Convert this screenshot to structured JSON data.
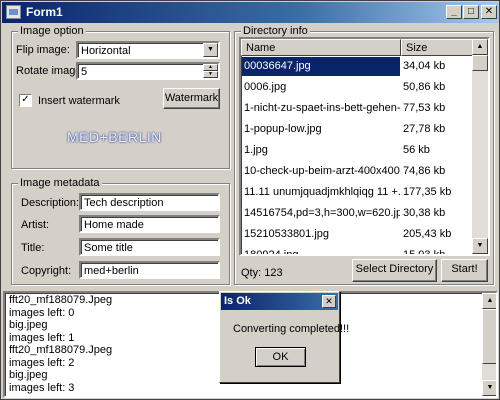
{
  "window": {
    "title": "Form1",
    "minimize": "_",
    "maximize": "□",
    "close": "✕",
    "icon": "app-icon"
  },
  "image_option": {
    "legend": "Image option",
    "flip_label": "Flip image:",
    "flip_value": "Horizontal",
    "rotate_label": "Rotate image:",
    "rotate_value": "5",
    "insert_watermark_label": "Insert watermark",
    "insert_watermark_checked": true,
    "watermark_button": "Watermark",
    "watermark_preview": "MED+BERLIN"
  },
  "image_metadata": {
    "legend": "Image metadata",
    "description_label": "Description:",
    "description_value": "Tech description",
    "artist_label": "Artist:",
    "artist_value": "Home made",
    "title_label": "Title:",
    "title_value": "Some title",
    "copyright_label": "Copyright:",
    "copyright_value": "med+berlin"
  },
  "directory_info": {
    "legend": "Directory info",
    "columns": {
      "name": "Name",
      "size": "Size"
    },
    "files": [
      {
        "name": "00036647.jpg",
        "size": "34,04 kb",
        "selected": true
      },
      {
        "name": "0006.jpg",
        "size": "50,86 kb"
      },
      {
        "name": "1-nicht-zu-spaet-ins-bett-gehen-40...",
        "size": "77,53 kb"
      },
      {
        "name": "1-popup-low.jpg",
        "size": "27,78 kb"
      },
      {
        "name": "1.jpg",
        "size": "56 kb"
      },
      {
        "name": "10-check-up-beim-arzt-400x400-1...",
        "size": "74,86 kb"
      },
      {
        "name": "11.11 unumjquadjmkhlqiqg 11 +.jpg",
        "size": "177,35 kb"
      },
      {
        "name": "14516754,pd=3,h=300,w=620.jpg",
        "size": "30,38 kb"
      },
      {
        "name": "15210533801.jpg",
        "size": "205,43 kb"
      },
      {
        "name": "180924.jpg",
        "size": "15,03 kb"
      }
    ],
    "qty_label": "Qty: 123",
    "select_directory_button": "Select Directory",
    "start_button": "Start!"
  },
  "log": {
    "lines": [
      "fft20_mf188079.Jpeg",
      " images left: 0",
      "big.jpeg",
      " images left: 1",
      "fft20_mf188079.Jpeg",
      " images left: 2",
      "big.jpeg",
      " images left: 3"
    ]
  },
  "dialog": {
    "title": "Is Ok",
    "message": "Converting completed!!!",
    "ok_button": "OK",
    "close": "✕"
  },
  "colors": {
    "titlebar": "#0a246a",
    "selection": "#0a246a",
    "face": "#d4d0c8"
  }
}
